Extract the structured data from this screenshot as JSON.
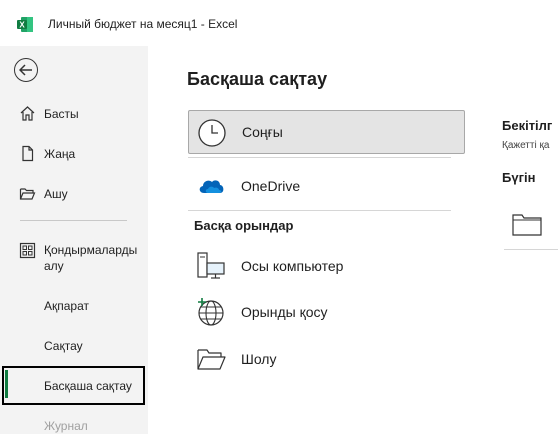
{
  "window": {
    "title": "Личный бюджет на месяц1  -  Excel",
    "app_icon": "excel-icon"
  },
  "nav": {
    "back_icon": "back-arrow-icon",
    "items": [
      {
        "label": "Басты",
        "icon": "home-icon"
      },
      {
        "label": "Жаңа",
        "icon": "new-document-icon"
      },
      {
        "label": "Ашу",
        "icon": "open-folder-icon"
      },
      {
        "label": "Қондырмаларды алу",
        "icon": "add-ins-icon"
      },
      {
        "label": "Ақпарат"
      },
      {
        "label": "Сақтау"
      },
      {
        "label": "Басқаша сақтау",
        "selected": true
      },
      {
        "label": "Журнал"
      }
    ]
  },
  "main": {
    "title": "Басқаша сақтау",
    "locations": [
      {
        "label": "Соңғы",
        "icon": "clock-icon",
        "selected": true
      },
      {
        "label": "OneDrive",
        "icon": "onedrive-cloud-icon"
      }
    ],
    "other_places_heading": "Басқа орындар",
    "other_places": [
      {
        "label": "Осы компьютер",
        "icon": "this-pc-icon"
      },
      {
        "label": "Орынды қосу",
        "icon": "add-place-icon"
      },
      {
        "label": "Шолу",
        "icon": "browse-folder-icon"
      }
    ]
  },
  "right_pane": {
    "title": "Бекітілг",
    "subtitle": "Қажетті қа",
    "today_label": "Бүгін",
    "folder_icon": "folder-icon"
  },
  "colors": {
    "excel_green": "#107c41",
    "onedrive_blue": "#0364b8",
    "nav_bg": "#f3f3f3",
    "selected_bg": "#e4e4e4"
  }
}
